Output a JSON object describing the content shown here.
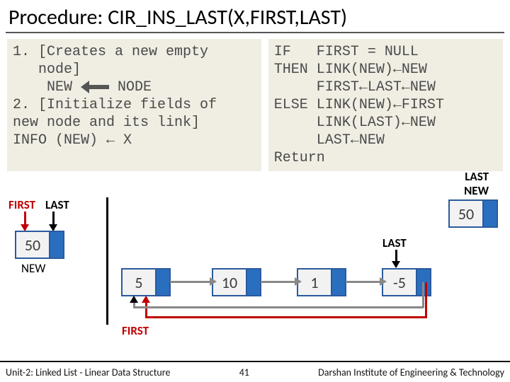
{
  "title": "Procedure: CIR_INS_LAST(X,FIRST,LAST)",
  "code_left": {
    "line1": "1. [Creates a new empty",
    "line2": "   node]",
    "line3a": "    NEW ",
    "line3b": " NODE",
    "line4": "2. [Initialize fields of",
    "line5": "new node and its link]",
    "line6": "INFO (NEW) ← X"
  },
  "code_right": {
    "l1": "IF   FIRST = NULL",
    "l2": "THEN LINK(NEW)←NEW",
    "l3": "     FIRST←LAST←NEW",
    "l4": "ELSE LINK(NEW)←FIRST",
    "l5": "     LINK(LAST)←NEW",
    "l6": "     LAST←NEW",
    "l7": "Return"
  },
  "labels": {
    "first": "FIRST",
    "last": "LAST",
    "new": "NEW"
  },
  "nodes": {
    "a": "50",
    "b": "5",
    "c": "10",
    "d": "1",
    "e": "-5",
    "f": "50"
  },
  "footer": {
    "left": "Unit-2: Linked List - Linear Data Structure",
    "page": "41",
    "right": "Darshan Institute of Engineering & Technology"
  }
}
